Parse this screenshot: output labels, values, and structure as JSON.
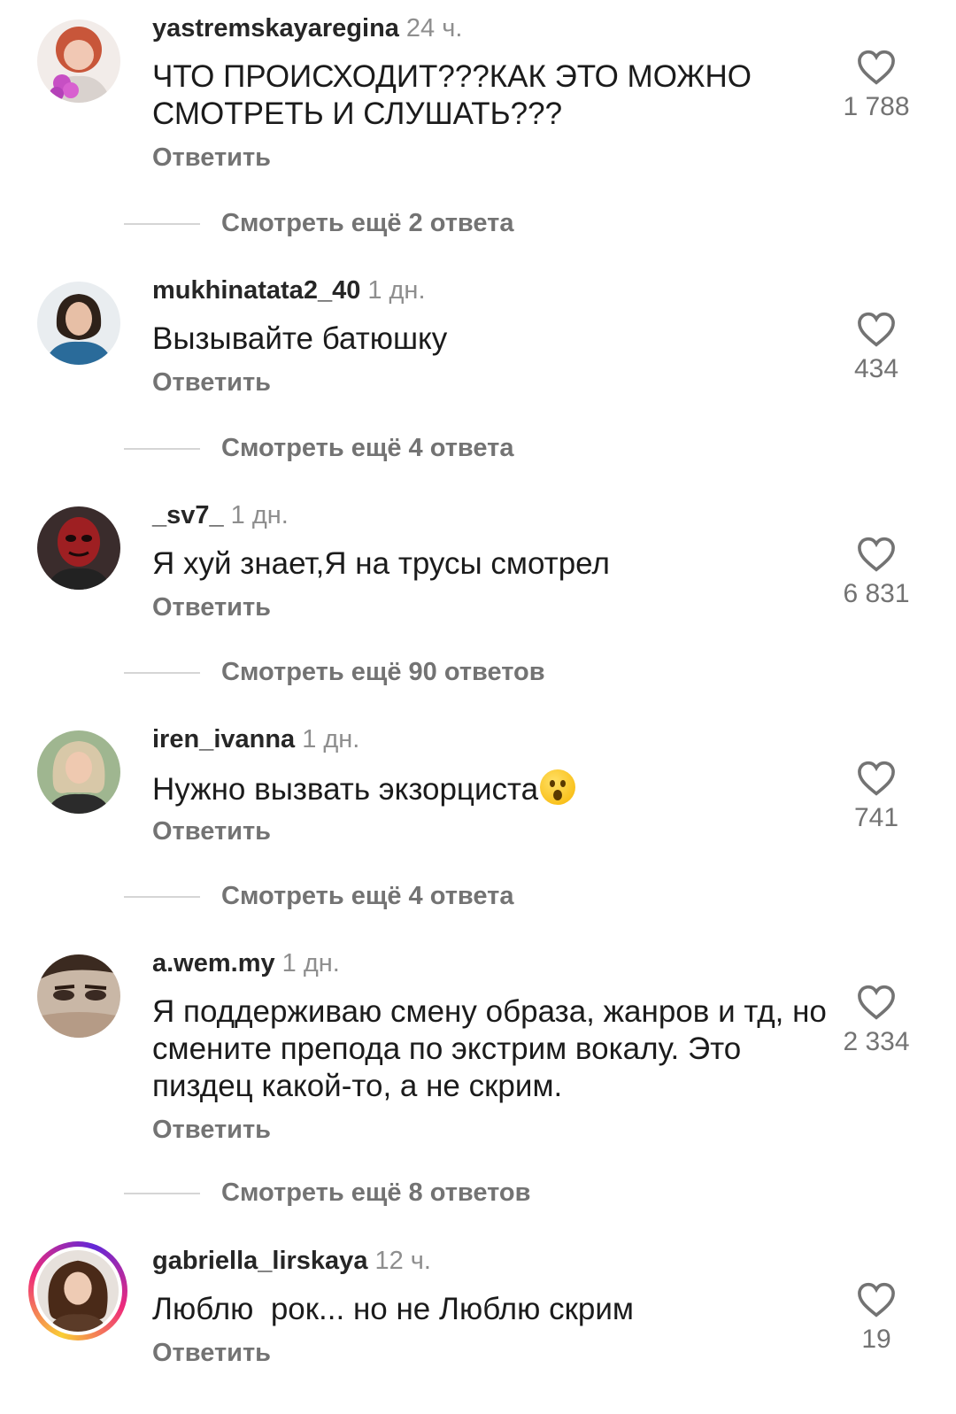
{
  "comments": [
    {
      "username": "yastremskayaregina",
      "time": "24 ч.",
      "text": "ЧТО ПРОИСХОДИТ???КАК ЭТО МОЖНО СМОТРЕТЬ И СЛУШАТЬ???",
      "reply_label": "Ответить",
      "likes": "1 788",
      "more_replies": "Смотреть ещё 2 ответа",
      "avatar_icon": "avatar-woman-red-hair-flowers"
    },
    {
      "username": "mukhinatata2_40",
      "time": "1 дн.",
      "text": "Вызывайте батюшку",
      "reply_label": "Ответить",
      "likes": "434",
      "more_replies": "Смотреть ещё 4 ответа",
      "avatar_icon": "avatar-woman-dark-hair-blue"
    },
    {
      "username": "_sv7_",
      "time": "1 дн.",
      "text": "Я хуй знает,Я на трусы смотрел",
      "reply_label": "Ответить",
      "likes": "6 831",
      "more_replies": "Смотреть ещё 90 ответов",
      "avatar_icon": "avatar-red-mask"
    },
    {
      "username": "iren_ivanna",
      "time": "1 дн.",
      "text": "Нужно вызвать экзорциста",
      "emoji": "hushed-face-emoji",
      "reply_label": "Ответить",
      "likes": "741",
      "more_replies": "Смотреть ещё 4 ответа",
      "avatar_icon": "avatar-woman-blonde"
    },
    {
      "username": "a.wem.my",
      "time": "1 дн.",
      "text": "Я поддерживаю смену образа, жанров и тд, но смените препода по экстрим вокалу. Это пиздец какой-то, а не скрим.",
      "reply_label": "Ответить",
      "likes": "2 334",
      "more_replies": "Смотреть ещё 8 ответов",
      "avatar_icon": "avatar-face-closeup"
    },
    {
      "username": "gabriella_lirskaya",
      "time": "12 ч.",
      "text": "Люблю  рок... но не Люблю скрим",
      "reply_label": "Ответить",
      "likes": "19",
      "avatar_icon": "avatar-woman-curly-hair-story-ring"
    }
  ],
  "colors": {
    "text": "#1b1b1b",
    "secondary": "#737373",
    "divider": "#d5d5d5",
    "story_ring_start": "#f9ce34",
    "story_ring_end": "#ee2a7b"
  }
}
